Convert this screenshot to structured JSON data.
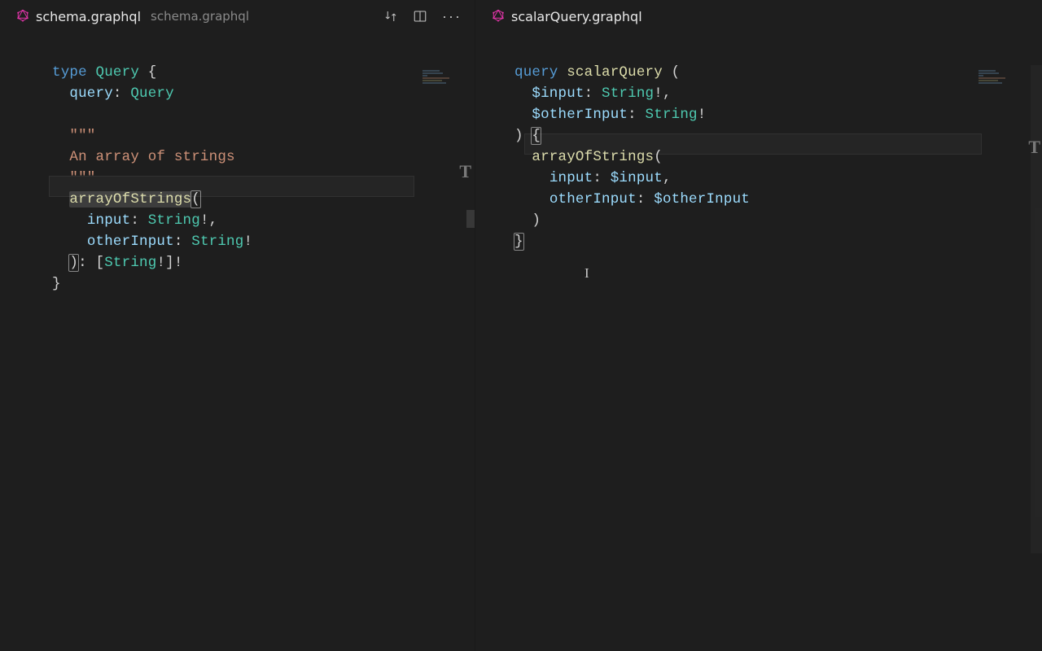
{
  "leftPane": {
    "tabTitle": "schema.graphql",
    "tabSubtitle": "schema.graphql",
    "code": {
      "l1_kw": "type",
      "l1_name": "Query",
      "l1_brace": "{",
      "l2_field": "query",
      "l2_colon": ":",
      "l2_type": "Query",
      "l4_q": "\"\"\"",
      "l5_doc": "An array of strings",
      "l6_q": "\"\"\"",
      "l7_field": "arrayOfStrings",
      "l7_paren": "(",
      "l8_arg": "input",
      "l8_colon": ":",
      "l8_type": "String",
      "l8_bang": "!,",
      "l9_arg": "otherInput",
      "l9_colon": ":",
      "l9_type": "String",
      "l9_bang": "!",
      "l10_close": ")",
      "l10_colon": ":",
      "l10_lb": "[",
      "l10_type": "String",
      "l10_bang1": "!",
      "l10_rb": "]",
      "l10_bang2": "!",
      "l11_close": "}"
    }
  },
  "rightPane": {
    "tabTitle": "scalarQuery.graphql",
    "code": {
      "l1_kw": "query",
      "l1_name": "scalarQuery",
      "l1_paren": "(",
      "l2_var": "$input",
      "l2_colon": ":",
      "l2_type": "String",
      "l2_bang": "!,",
      "l3_var": "$otherInput",
      "l3_colon": ":",
      "l3_type": "String",
      "l3_bang": "!",
      "l4_close": ")",
      "l4_brace": "{",
      "l5_field": "arrayOfStrings",
      "l5_paren": "(",
      "l6_arg": "input",
      "l6_colon": ":",
      "l6_var": "$input",
      "l6_comma": ",",
      "l7_arg": "otherInput",
      "l7_colon": ":",
      "l7_var": "$otherInput",
      "l8_close": ")",
      "l9_close": "}"
    }
  }
}
